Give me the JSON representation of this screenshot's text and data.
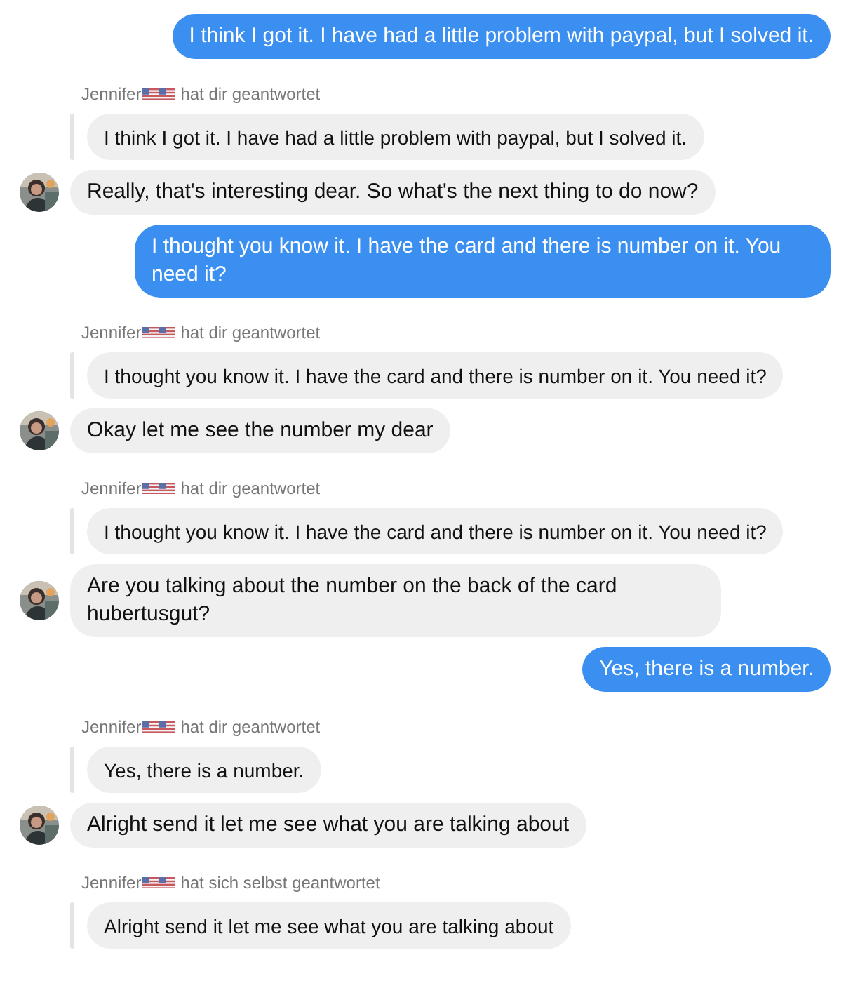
{
  "messages": [
    {
      "kind": "sent",
      "text": "I think I got it. I have had a little problem with paypal, but I solved it."
    },
    {
      "kind": "received",
      "name": "Jennifer",
      "action": "hat dir geantwortet",
      "quote": "I think I got it. I have had a little problem with paypal, but I solved it.",
      "text": "Really, that's interesting dear. So what's the next thing to do now?"
    },
    {
      "kind": "sent",
      "text": "I thought you know it. I have the card and there is number on it. You need it?"
    },
    {
      "kind": "received",
      "name": "Jennifer",
      "action": "hat dir geantwortet",
      "quote": "I thought you know it. I have the card and there is number on it. You need it?",
      "text": "Okay let me see the number my dear"
    },
    {
      "kind": "received",
      "name": "Jennifer",
      "action": "hat dir geantwortet",
      "quote": "I thought you know it. I have the card and there is number on it. You need it?",
      "text": "Are you talking about the number on the back of the card hubertusgut?"
    },
    {
      "kind": "sent",
      "text": "Yes, there is a number."
    },
    {
      "kind": "received",
      "name": "Jennifer",
      "action": "hat dir geantwortet",
      "quote": "Yes, there is a number.",
      "text": "Alright send it let me see what you are talking about"
    },
    {
      "kind": "received",
      "name": "Jennifer",
      "action": "hat sich selbst geantwortet",
      "quote": "Alright send it let me see what you are talking about"
    }
  ]
}
